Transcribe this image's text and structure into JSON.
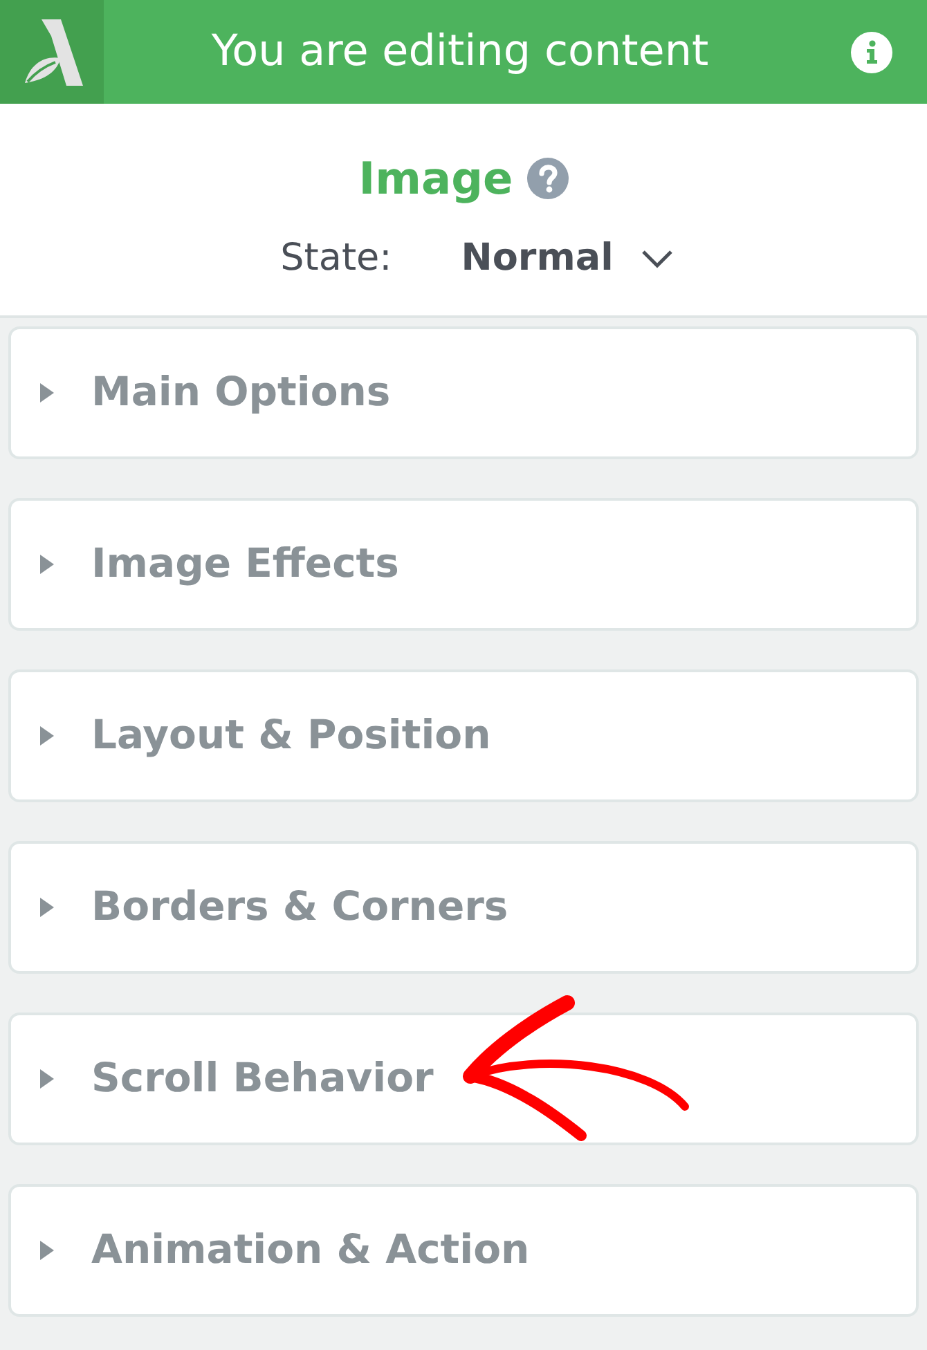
{
  "header": {
    "title": "You are editing content"
  },
  "element": {
    "title": "Image"
  },
  "state": {
    "label": "State:",
    "value": "Normal"
  },
  "sections": [
    {
      "label": "Main Options",
      "expanded": false
    },
    {
      "label": "Image Effects",
      "expanded": false
    },
    {
      "label": "Layout & Position",
      "expanded": false
    },
    {
      "label": "Borders & Corners",
      "expanded": false
    },
    {
      "label": "Scroll Behavior",
      "expanded": false
    },
    {
      "label": "Animation & Action",
      "expanded": false
    }
  ]
}
